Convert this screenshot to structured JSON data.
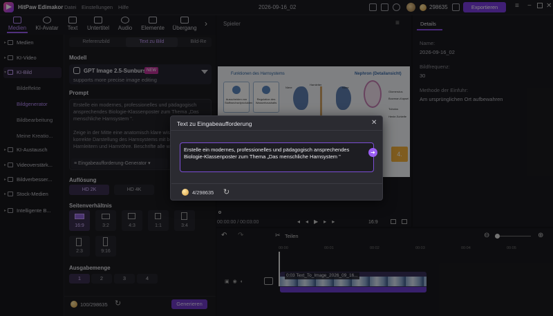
{
  "app": {
    "title": "HitPaw Edimakor",
    "menu": [
      "Datei",
      "Einstellungen",
      "Hilfe"
    ],
    "doc_name": "2026-09-16_02",
    "credits": "298635",
    "export_label": "Exportieren"
  },
  "toolbar_tabs": [
    {
      "label": "Medien",
      "icon": "media-icon",
      "active": true
    },
    {
      "label": "KI-Avatar",
      "icon": "avatar-icon"
    },
    {
      "label": "Text",
      "icon": "text-icon"
    },
    {
      "label": "Untertitel",
      "icon": "subtitle-icon"
    },
    {
      "label": "Audio",
      "icon": "audio-icon"
    },
    {
      "label": "Elemente",
      "icon": "elements-icon"
    },
    {
      "label": "Übergang",
      "icon": "transition-icon"
    }
  ],
  "sidebar": {
    "items": [
      "Medien",
      "KI-Video",
      "KI-Bild",
      "KI-Austausch",
      "Videoverstärk...",
      "Bildverbesser...",
      "Stock-Medien",
      "Intelligente B..."
    ],
    "active_item": "KI-Bild",
    "subitems": [
      "Bildeffekte",
      "Bildgenerator",
      "Bildbearbeitung",
      "Meine Kreatio..."
    ],
    "active_sub": "Bildgenerator"
  },
  "panel": {
    "segments": [
      "Referenzbild",
      "Text zu Bild",
      "Bild-Re"
    ],
    "active_segment": "Text zu Bild",
    "model_heading": "Modell",
    "model_name": "GPT Image 2.5-Sunburst",
    "model_badge": "NEW",
    "model_desc": "supports more precise image editing",
    "prompt_heading": "Prompt",
    "prompt_text": "Erstelle ein modernes, professionelles und pädagogisch ansprechendes Biologie-Klassenposter zum Thema „Das menschliche Harnsystem \".\n\nZeige in der Mitte eine anatomisch klare wissenschaftlich korrekte Darstellung des Harnsystems mit beiden Nieren, Harnleitern und Harnröhre. Beschrifte alle wichtigen",
    "prompt_gen_label": "Eingabeaufforderung-Generator",
    "resolution_heading": "Auflösung",
    "resolutions": [
      "HD 2K",
      "HD 4K"
    ],
    "active_resolution": "HD 2K",
    "ratio_heading": "Seitenverhältnis",
    "ratios": [
      "16:9",
      "3:2",
      "4:3",
      "1:1",
      "3:4",
      "2:3",
      "9:16"
    ],
    "active_ratio": "16:9",
    "count_heading": "Ausgabemenge",
    "counts": [
      "1",
      "2",
      "3",
      "4"
    ],
    "active_count": "1",
    "cost": "100/298635",
    "generate_label": "Generieren"
  },
  "player": {
    "title": "Spieler",
    "time": "00:00:00 / 00:03:00",
    "ratio": "16:9",
    "poster": {
      "left_title": "Funktionen des Harnsystems",
      "right_title": "Nephron (Detailansicht)",
      "card1": "Ausscheiden von Stoffwechselprodukten",
      "card2": "Regulation des Wasserhaushalts",
      "labels": [
        "Niere",
        "Harnleiter",
        "Niere",
        "Glomerulus",
        "Bowman-Kapsel",
        "Tubulus",
        "Henle-Schleife"
      ],
      "badge": "4."
    }
  },
  "details": {
    "tab": "Details",
    "name_label": "Name:",
    "name_value": "2026-09-16_02",
    "fps_label": "Bildfrequenz:",
    "fps_value": "30",
    "method_label": "Methode der Einfuhr:",
    "method_value": "Am ursprünglichen Ort aufbewahren"
  },
  "timeline": {
    "share_label": "Teilen",
    "ticks": [
      "00:00",
      "00:01",
      "00:02",
      "00:03",
      "00:04",
      "00:05",
      "00:06"
    ],
    "clip_label": "0:03 Text_To_Image_2026_09_16..."
  },
  "dialog": {
    "title": "Text zu Eingabeaufforderung",
    "input_text": "Erstelle ein modernes, professionelles und pädagogisch ansprechendes Biologie-Klassenposter zum Thema „Das menschliche Harnsystem \"",
    "credits": "4/298635"
  },
  "colors": {
    "accent": "#8b50e8",
    "background": "#141417"
  }
}
